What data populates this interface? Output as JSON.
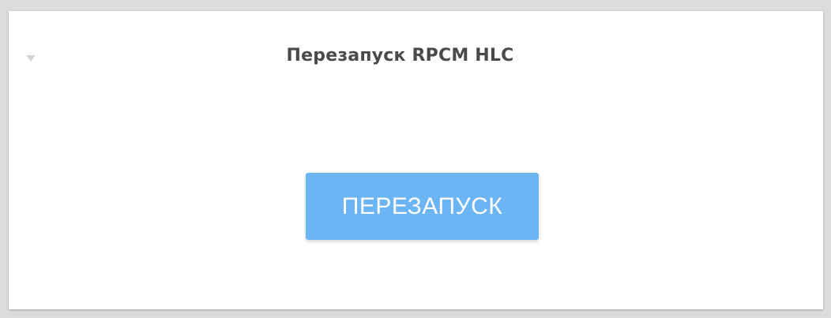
{
  "panel": {
    "title": "Перезапуск RPCM HLC",
    "toggle_icon": "triangle-down-icon"
  },
  "actions": {
    "restart_label": "ПЕРЕЗАПУСК"
  },
  "colors": {
    "button_bg": "#6cb5f5",
    "button_text": "#ffffff",
    "title_text": "#4a4a4a",
    "card_bg": "#ffffff",
    "page_bg": "#dcdcdc"
  }
}
